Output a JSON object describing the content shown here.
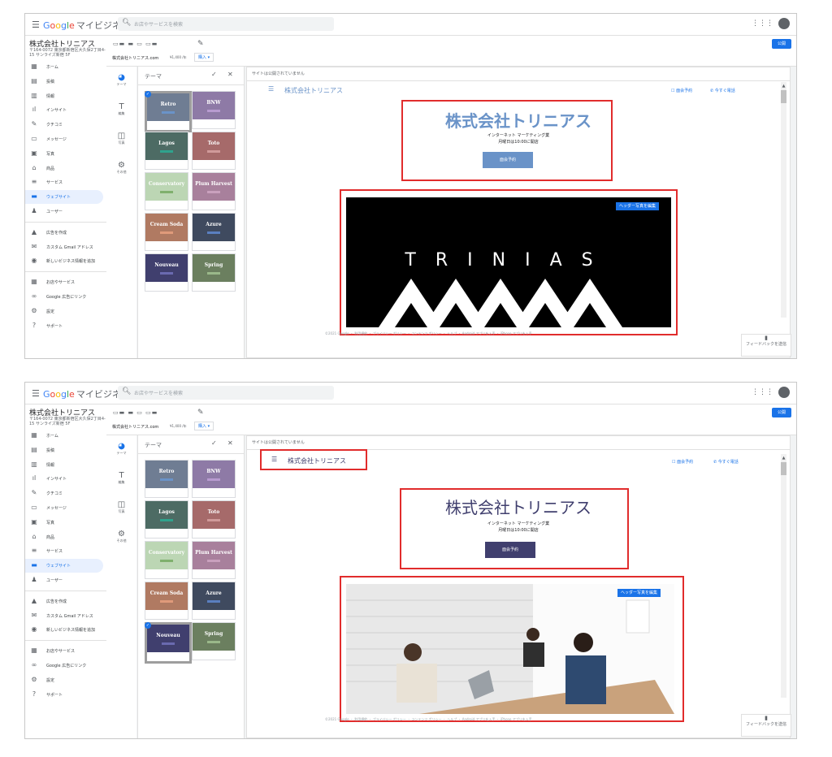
{
  "colors": {
    "accent": "#1a73e8",
    "red_highlight": "#e12c2c",
    "retro_blue": "#6a93c8",
    "nouveau_navy": "#403f6e"
  },
  "header": {
    "menu_icon": "hamburger-icon",
    "logo_g": "G",
    "logo_o1": "o",
    "logo_o2": "o",
    "logo_g2": "g",
    "logo_l": "l",
    "logo_e": "e",
    "product": "マイビジネス",
    "search_icon": "search-icon",
    "search_placeholder": "お店やサービスを検索",
    "apps_icon": "apps-grid-icon"
  },
  "business": {
    "name": "株式会社トリニアス",
    "address": "〒164-0072 東京都新宿区大久保2丁目4-15 サンライズ新宿 5F"
  },
  "sidebar": {
    "items": [
      {
        "icon": "home-icon",
        "label": "ホーム"
      },
      {
        "icon": "posts-icon",
        "label": "投稿"
      },
      {
        "icon": "info-icon",
        "label": "情報"
      },
      {
        "icon": "insights-icon",
        "label": "インサイト"
      },
      {
        "icon": "reviews-icon",
        "label": "クチコミ"
      },
      {
        "icon": "messages-icon",
        "label": "メッセージ"
      },
      {
        "icon": "photos-icon",
        "label": "写真"
      },
      {
        "icon": "products-icon",
        "label": "商品"
      },
      {
        "icon": "services-icon",
        "label": "サービス"
      },
      {
        "icon": "website-icon",
        "label": "ウェブサイト"
      },
      {
        "icon": "users-icon",
        "label": "ユーザー"
      }
    ],
    "extra": [
      {
        "icon": "ads-icon",
        "label": "広告を作成"
      },
      {
        "icon": "gmail-icon",
        "label": "カスタム Gmail アドレス"
      },
      {
        "icon": "location-icon",
        "label": "新しいビジネス情報を追加"
      }
    ],
    "bottom": [
      {
        "icon": "store-icon",
        "label": "お店やサービス"
      },
      {
        "icon": "link-icon",
        "label": "Google 広告にリンク"
      },
      {
        "icon": "settings-icon",
        "label": "設定"
      },
      {
        "icon": "help-icon",
        "label": "サポート"
      }
    ]
  },
  "site": {
    "domain": "株式会社トリニアス.com",
    "price": "¥1,400 /年",
    "buy_label": "購入",
    "publish_label": "公開",
    "unpublished_note": "サイトは公開されていません"
  },
  "rail": [
    {
      "icon": "palette-icon",
      "label": "テーマ"
    },
    {
      "icon": "text-edit-icon",
      "label": "編集"
    },
    {
      "icon": "photo-icon",
      "label": "写真"
    },
    {
      "icon": "gear-icon",
      "label": "その他"
    }
  ],
  "theme_panel": {
    "title": "テーマ",
    "check_icon": "check-icon",
    "close_icon": "close-icon",
    "themes": [
      {
        "name": "Retro",
        "color": "#6f7d93",
        "bar": "#6a93c8"
      },
      {
        "name": "BNW",
        "color": "#8e7aa6",
        "bar": "#b89bd0"
      },
      {
        "name": "Lagos",
        "color": "#4d6b64",
        "bar": "#2fa38d"
      },
      {
        "name": "Toto",
        "color": "#a66a6a",
        "bar": "#d09a9a"
      },
      {
        "name": "Conservatory",
        "color": "#bcd6b4",
        "bar": "#7fb06d"
      },
      {
        "name": "Plum Harvest",
        "color": "#a8809c",
        "bar": "#c9a0bd"
      },
      {
        "name": "Cream Soda",
        "color": "#b07a62",
        "bar": "#e09a7a"
      },
      {
        "name": "Azure",
        "color": "#3f4a5f",
        "bar": "#5a7fc0"
      },
      {
        "name": "Nouveau",
        "color": "#403f6e",
        "bar": "#6a6ab0"
      },
      {
        "name": "Spring",
        "color": "#6b7f5f",
        "bar": "#9ab88a"
      }
    ]
  },
  "preview1": {
    "menu_icon": "hamburger-icon",
    "site_name": "株式会社トリニアス",
    "contact_label": "面会予約",
    "call_label": "今すぐ電話",
    "hero_title": "株式会社トリニアス",
    "hero_sub1": "インターネット マーケティング業",
    "hero_sub2": "月曜日は10:00に開店",
    "cta_label": "面会予約",
    "edit_header_label": "ヘッダー写真を編集",
    "logo_text": "TRINIAS",
    "selected_theme": "Retro"
  },
  "preview2": {
    "menu_icon": "hamburger-icon",
    "site_name": "株式会社トリニアス",
    "contact_label": "面会予約",
    "call_label": "今すぐ電話",
    "hero_title": "株式会社トリニアス",
    "hero_sub1": "インターネット マーケティング業",
    "hero_sub2": "月曜日は10:00に開店",
    "cta_label": "面会予約",
    "edit_header_label": "ヘッダー写真を編集",
    "selected_theme": "Nouveau"
  },
  "footer": {
    "text": "©2021 Google ・ 利用規約 ・ プライバシー ポリシー ・ コンテンツ ポリシー ・ ヘルプ ・ Android アプリを入手 ・ iPhone アプリを入手",
    "feedback_icon": "feedback-icon",
    "feedback_label": "フィードバックを送信"
  }
}
